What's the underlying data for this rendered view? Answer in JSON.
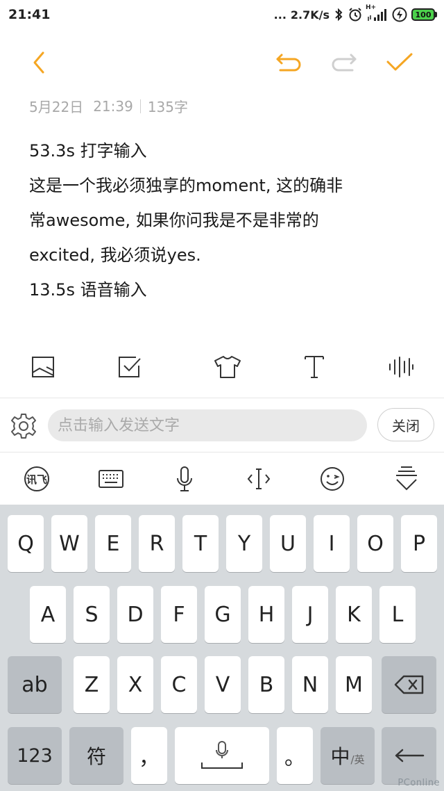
{
  "status_bar": {
    "time": "21:41",
    "dots": "...",
    "net_speed": "2.7K/s",
    "net_type": "H+",
    "battery": "100",
    "icons": [
      "bluetooth-icon",
      "alarm-icon",
      "signal-icon",
      "charging-icon",
      "battery-icon"
    ],
    "battery_color": "#4cd14c"
  },
  "header": {
    "icons": [
      "back-icon",
      "undo-icon",
      "redo-icon",
      "done-check-icon"
    ],
    "accent_color": "#f5a623"
  },
  "meta": {
    "date": "5月22日",
    "time": "21:39",
    "count": "135字"
  },
  "note": {
    "lines": [
      "53.3s 打字输入",
      "这是一个我必须独享的moment, 这的确非",
      "常awesome, 如果你问我是不是非常的",
      "excited, 我必须说yes.",
      "13.5s 语音输入"
    ]
  },
  "format_toolbar": {
    "icons": [
      "image-icon",
      "checkbox-icon",
      "shirt-icon",
      "text-icon",
      "voice-wave-icon"
    ]
  },
  "input_bar": {
    "placeholder": "点击输入发送文字",
    "close_label": "关闭",
    "icons": [
      "gear-icon"
    ]
  },
  "ime_toolbar": {
    "logo_text": "讯飞",
    "icons": [
      "ifly-logo-icon",
      "keyboard-icon",
      "mic-icon",
      "cursor-move-icon",
      "emoji-icon",
      "collapse-keyboard-icon"
    ]
  },
  "keyboard": {
    "row1": [
      "Q",
      "W",
      "E",
      "R",
      "T",
      "Y",
      "U",
      "I",
      "O",
      "P"
    ],
    "row2": [
      "A",
      "S",
      "D",
      "F",
      "G",
      "H",
      "J",
      "K",
      "L"
    ],
    "row3": [
      "Z",
      "X",
      "C",
      "V",
      "B",
      "N",
      "M"
    ],
    "ab_label": "ab",
    "num_label": "123",
    "symbol_label": "符",
    "comma_label": "，",
    "period_label": "。",
    "lang_main": "中",
    "lang_sub": "/英",
    "icons": [
      "backspace-icon",
      "space-mic-icon",
      "enter-icon"
    ]
  },
  "watermark": "PConline"
}
